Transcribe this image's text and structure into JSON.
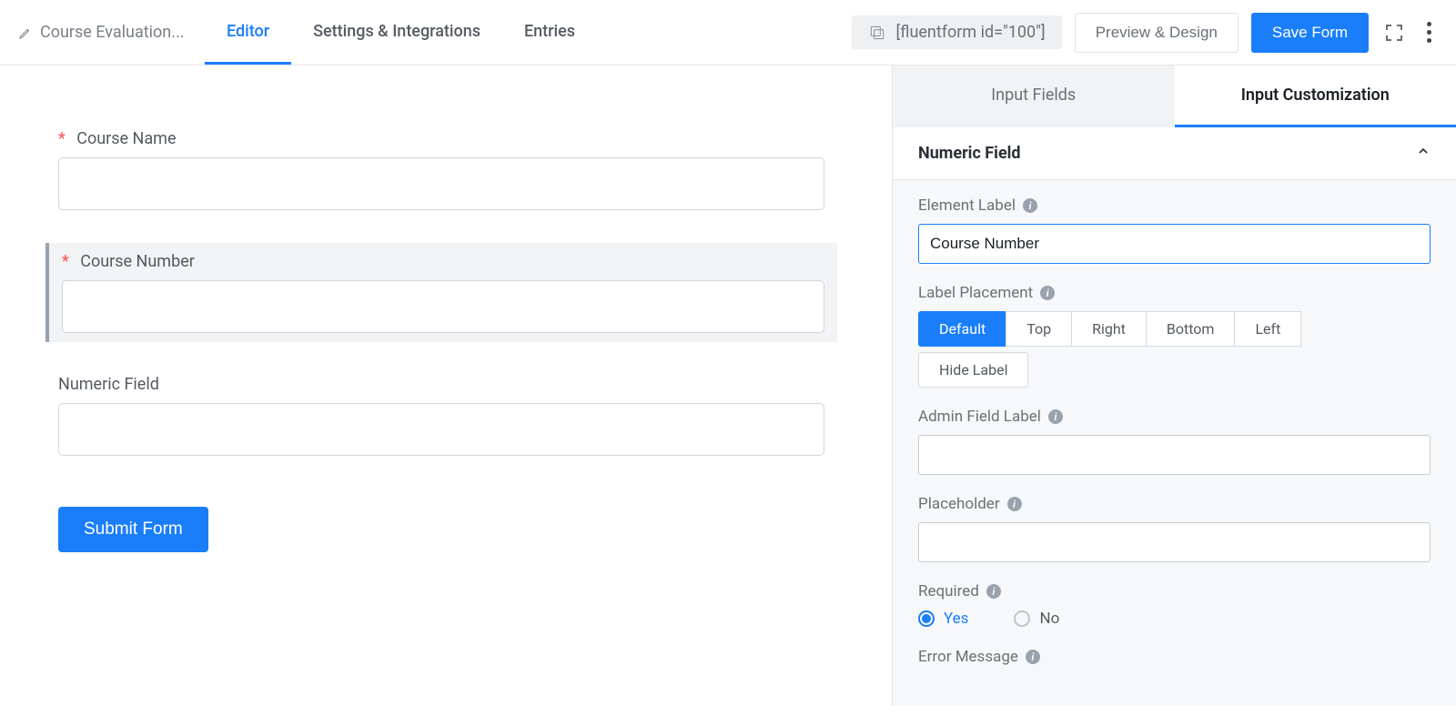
{
  "header": {
    "form_title": "Course Evaluation...",
    "tabs": [
      "Editor",
      "Settings & Integrations",
      "Entries"
    ],
    "shortcode": "[fluentform id=\"100\"]",
    "preview_btn": "Preview & Design",
    "save_btn": "Save Form"
  },
  "canvas": {
    "fields": [
      {
        "label": "Course Name",
        "required": true
      },
      {
        "label": "Course Number",
        "required": true
      },
      {
        "label": "Numeric Field",
        "required": false
      }
    ],
    "submit_label": "Submit Form"
  },
  "sidebar": {
    "tabs": [
      "Input Fields",
      "Input Customization"
    ],
    "panel_title": "Numeric Field",
    "settings": {
      "element_label": {
        "label": "Element Label",
        "value": "Course Number"
      },
      "label_placement": {
        "label": "Label Placement",
        "options": [
          "Default",
          "Top",
          "Right",
          "Bottom",
          "Left",
          "Hide Label"
        ],
        "selected": "Default"
      },
      "admin_field_label": {
        "label": "Admin Field Label",
        "value": ""
      },
      "placeholder": {
        "label": "Placeholder",
        "value": ""
      },
      "required": {
        "label": "Required",
        "options": [
          "Yes",
          "No"
        ],
        "selected": "Yes"
      },
      "error_message": {
        "label": "Error Message"
      }
    }
  }
}
